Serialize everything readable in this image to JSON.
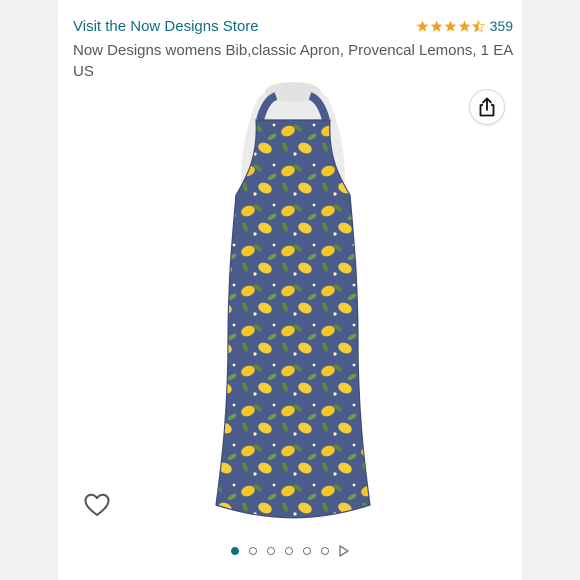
{
  "header": {
    "store_link": "Visit the Now Designs Store",
    "rating_value": 4.5,
    "rating_count": "359"
  },
  "product": {
    "title": "Now Designs womens Bib,classic Apron, Provencal Lemons, 1 EA US"
  },
  "icons": {
    "share": "share-icon",
    "wishlist": "heart-icon",
    "star": "star-icon",
    "next": "play-next-icon"
  },
  "carousel": {
    "image_count": 5,
    "active_index": 0
  },
  "colors": {
    "link": "#0f6e80",
    "star": "#f0a31a",
    "apron_base": "#4a5b8c",
    "lemon": "#f2c628",
    "leaf": "#5f8a3a"
  }
}
